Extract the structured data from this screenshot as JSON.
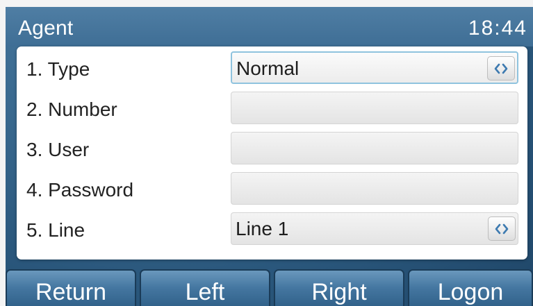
{
  "header": {
    "title": "Agent",
    "time": "18:44"
  },
  "form": {
    "rows": [
      {
        "label": "1. Type",
        "value": "Normal",
        "has_selector": true,
        "selected": true
      },
      {
        "label": "2. Number",
        "value": "",
        "has_selector": false,
        "selected": false
      },
      {
        "label": "3. User",
        "value": "",
        "has_selector": false,
        "selected": false
      },
      {
        "label": "4. Password",
        "value": "",
        "has_selector": false,
        "selected": false
      },
      {
        "label": "5. Line",
        "value": "Line 1",
        "has_selector": true,
        "selected": false
      }
    ],
    "selector_icon": "left-right-arrows-icon"
  },
  "softkeys": [
    "Return",
    "Left",
    "Right",
    "Logon"
  ],
  "colors": {
    "background": "#2c5a7c",
    "titlebar": "#4f7ea4",
    "selected_border": "#8fc3de",
    "softkey": "#4476a0",
    "arrow_icon": "#3d7ab0"
  }
}
